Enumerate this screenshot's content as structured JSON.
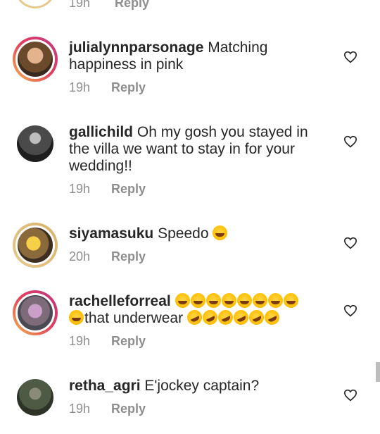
{
  "top_fragment": {
    "time": "19h",
    "reply": "Reply"
  },
  "comments": [
    {
      "username": "julialynnparsonage",
      "text": "Matching happiness in pink",
      "time": "19h",
      "reply": "Reply"
    },
    {
      "username": "gallichild",
      "text": "Oh my gosh you stayed in the villa we want to stay in for your wedding!!",
      "time": "19h",
      "reply": "Reply"
    },
    {
      "username": "siyamasuku",
      "text": "Speedo",
      "time": "20h",
      "reply": "Reply"
    },
    {
      "username": "rachelleforreal",
      "text": "that underwear",
      "time": "19h",
      "reply": "Reply"
    },
    {
      "username": "retha_agri",
      "text": "E'jockey captain?",
      "time": "19h",
      "reply": "Reply"
    }
  ]
}
